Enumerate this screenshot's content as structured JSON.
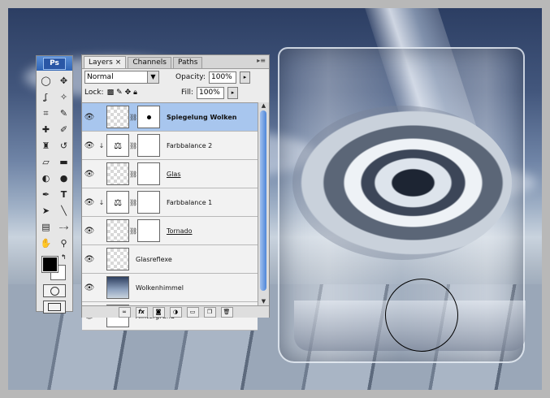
{
  "toolbox": {
    "logo": "Ps",
    "tools": [
      "marquee-icon",
      "move-icon",
      "lasso-icon",
      "magic-wand-icon",
      "crop-icon",
      "slice-icon",
      "healing-icon",
      "brush-icon",
      "stamp-icon",
      "history-brush-icon",
      "eraser-icon",
      "gradient-icon",
      "blur-icon",
      "dodge-icon",
      "pen-icon",
      "type-icon",
      "path-select-icon",
      "line-icon",
      "notes-icon",
      "eyedropper-icon",
      "hand-icon",
      "zoom-icon"
    ],
    "foreground": "#000000",
    "background": "#ffffff"
  },
  "layers_panel": {
    "tabs": [
      {
        "label": "Layers",
        "active": true,
        "close": "×"
      },
      {
        "label": "Channels",
        "active": false
      },
      {
        "label": "Paths",
        "active": false
      }
    ],
    "blend_mode": "Normal",
    "opacity_label": "Opacity:",
    "opacity_value": "100%",
    "lock_label": "Lock:",
    "fill_label": "Fill:",
    "fill_value": "100%",
    "layers": [
      {
        "name": "Spiegelung Wolken",
        "thumb": "transparent",
        "mask": true,
        "selected": true,
        "style": "bold"
      },
      {
        "name": "Farbbalance 2",
        "thumb": "adjustment",
        "mask": true,
        "selected": false,
        "style": "normal"
      },
      {
        "name": "Glas",
        "thumb": "transparent",
        "mask": true,
        "selected": false,
        "style": "underline"
      },
      {
        "name": "Farbbalance 1",
        "thumb": "adjustment",
        "mask": true,
        "selected": false,
        "style": "normal"
      },
      {
        "name": "Tornado",
        "thumb": "transparent",
        "mask": true,
        "selected": false,
        "style": "underline"
      },
      {
        "name": "Glasreflexe",
        "thumb": "transparent",
        "mask": false,
        "selected": false,
        "style": "normal"
      },
      {
        "name": "Wolkenhimmel",
        "thumb": "sky",
        "mask": false,
        "selected": false,
        "style": "normal"
      },
      {
        "name": "Hintergrund",
        "thumb": "white",
        "mask": false,
        "selected": false,
        "style": "italic",
        "locked": true
      }
    ],
    "footer_buttons": [
      "link-layers-icon",
      "fx-icon",
      "add-mask-icon",
      "adjustment-layer-icon",
      "group-icon",
      "new-layer-icon",
      "trash-icon"
    ]
  }
}
